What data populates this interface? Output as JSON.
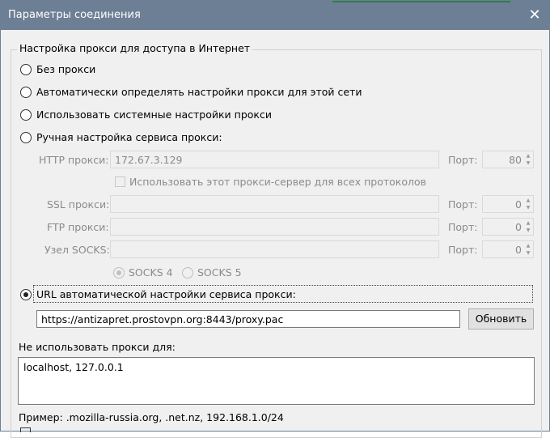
{
  "window": {
    "title": "Параметры соединения",
    "close_glyph": "✕"
  },
  "proxy": {
    "group_label": "Настройка прокси для доступа в Интернет",
    "options": [
      "Без прокси",
      "Автоматически определять настройки прокси для этой сети",
      "Использовать системные настройки прокси",
      "Ручная настройка сервиса прокси:",
      "URL автоматической настройки сервиса прокси:"
    ],
    "selected_option": "URL автоматической настройки сервиса прокси:",
    "port_label": "Порт:",
    "http": {
      "label": "HTTP прокси:",
      "value": "172.67.3.129",
      "port": "80"
    },
    "use_for_all_label": "Использовать этот прокси-сервер для всех протоколов",
    "ssl": {
      "label": "SSL прокси:",
      "value": "",
      "port": "0"
    },
    "ftp": {
      "label": "FTP прокси:",
      "value": "",
      "port": "0"
    },
    "socks": {
      "label": "Узел SOCKS:",
      "value": "",
      "port": "0"
    },
    "socks_versions": [
      "SOCKS 4",
      "SOCKS 5"
    ],
    "socks_selected": "SOCKS 4",
    "pac_url": "https://antizapret.prostovpn.org:8443/proxy.pac",
    "reload_label": "Обновить"
  },
  "no_proxy": {
    "label": "Не использовать прокси для:",
    "value": "localhost, 127.0.0.1",
    "example": "Пример: .mozilla-russia.org, .net.nz, 192.168.1.0/24"
  },
  "colors": {
    "titlebar": "#6d7f95",
    "window_bg": "#f0f0f0",
    "accent": "#2d7d4c"
  }
}
